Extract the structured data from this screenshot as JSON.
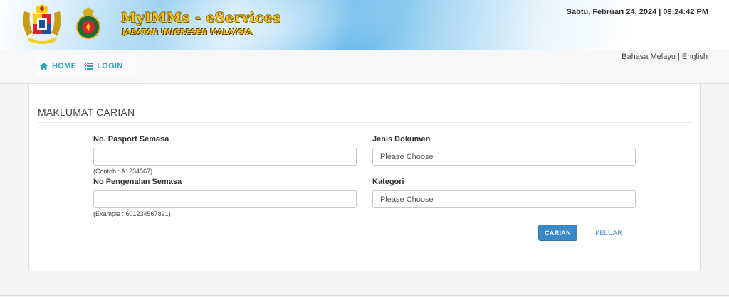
{
  "header": {
    "brand_title": "MyIMMs - eServices",
    "brand_subtitle": "JABATAN IMIGRESEN MALAYSIA",
    "datetime": "Sabtu, Februari 24, 2024 | 09:24:42 PM"
  },
  "nav": {
    "home_label": "HOME",
    "login_label": "LOGIN",
    "icons": [
      "home-icon",
      "list-icon"
    ]
  },
  "language": {
    "bm": "Bahasa Melayu",
    "separator": " | ",
    "en": "English"
  },
  "section": {
    "title": "MAKLUMAT CARIAN"
  },
  "form": {
    "passport_label": "No. Pasport Semasa",
    "passport_value": "",
    "passport_hint": "(Contoh : A1234567)",
    "id_label": "No Pengenalan Semasa",
    "id_value": "",
    "id_hint": "(Example : 601234567891)",
    "doc_type_label": "Jenis Dokumen",
    "doc_type_selected": "Please Choose",
    "category_label": "Kategori",
    "category_selected": "Please Choose"
  },
  "actions": {
    "search_label": "CARIAN",
    "exit_label": "KELUAR"
  },
  "colors": {
    "accent": "#2aa3b6",
    "primary_button": "#3a88c8",
    "brand_gold": "#f4c31a"
  }
}
